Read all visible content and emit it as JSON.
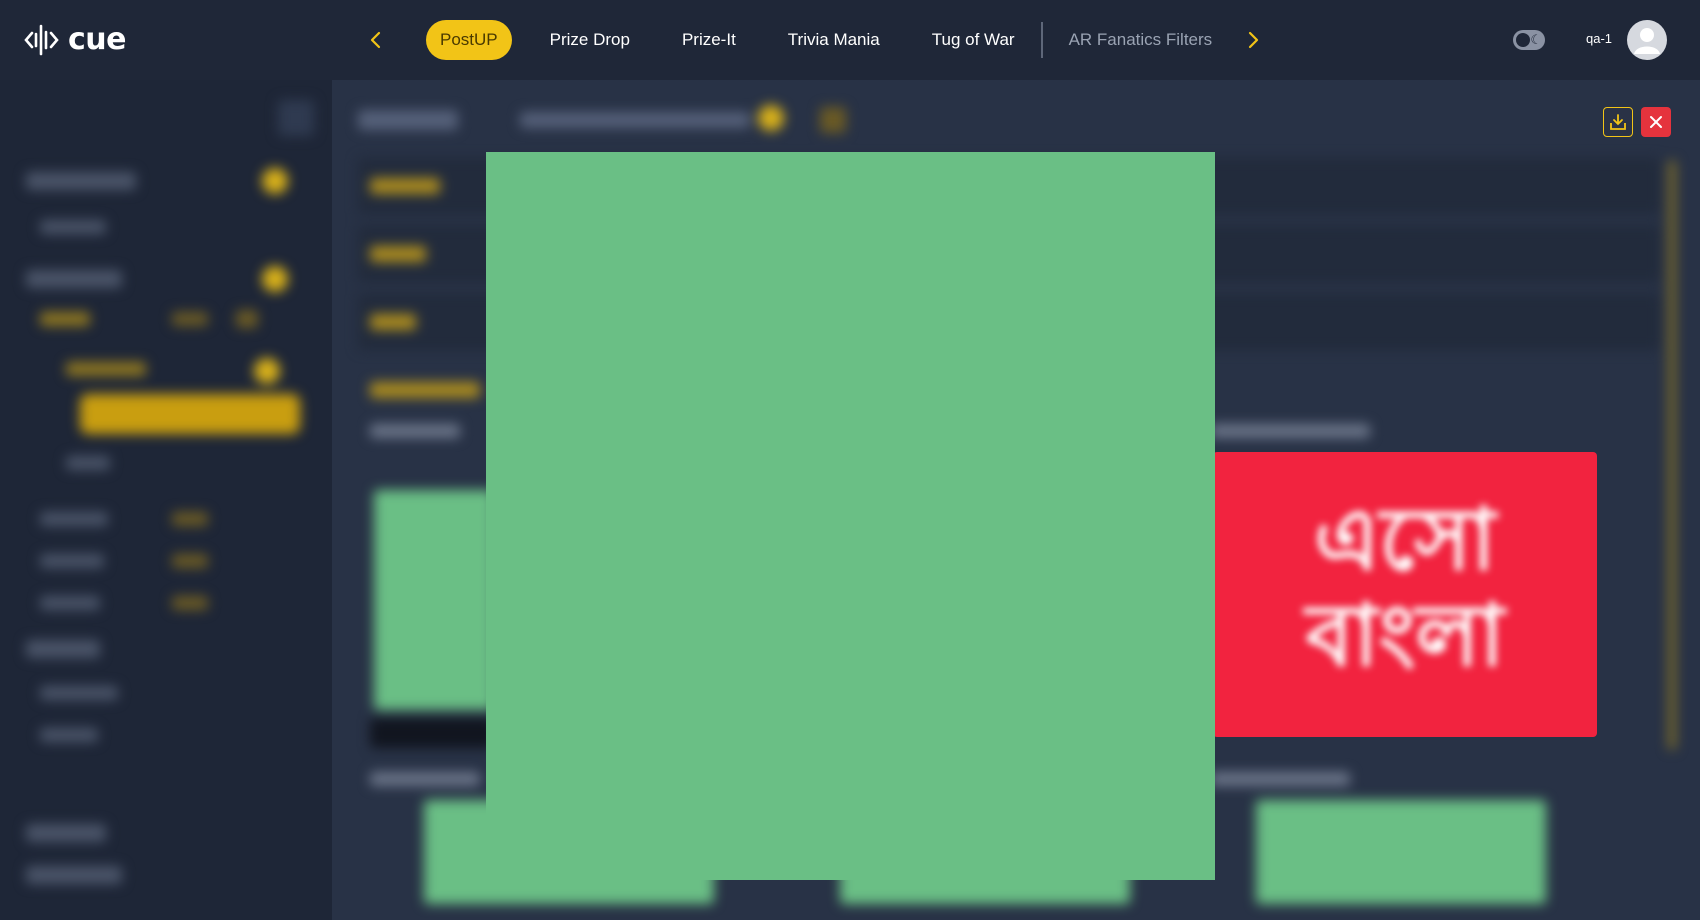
{
  "brand": {
    "name": "cue"
  },
  "nav": {
    "tabs": [
      {
        "label": "PostUP",
        "active": true
      },
      {
        "label": "Prize Drop"
      },
      {
        "label": "Prize-It"
      },
      {
        "label": "Trivia Mania"
      },
      {
        "label": "Tug of War"
      },
      {
        "label": "AR Fanatics Filters",
        "dimmed": true
      }
    ]
  },
  "user": {
    "name": "qa-1"
  },
  "colors": {
    "accent": "#f2c417",
    "background": "#1e2637",
    "panel": "#283246",
    "danger": "#e5333d",
    "placeholder_green": "#6abf85",
    "card_red": "#f2233f"
  },
  "icons": {
    "nav_prev": "chevron-left-icon",
    "nav_next": "chevron-right-icon",
    "theme": "dark-mode-toggle-icon",
    "avatar": "user-avatar-icon",
    "save": "download-tray-icon",
    "close": "close-icon"
  }
}
